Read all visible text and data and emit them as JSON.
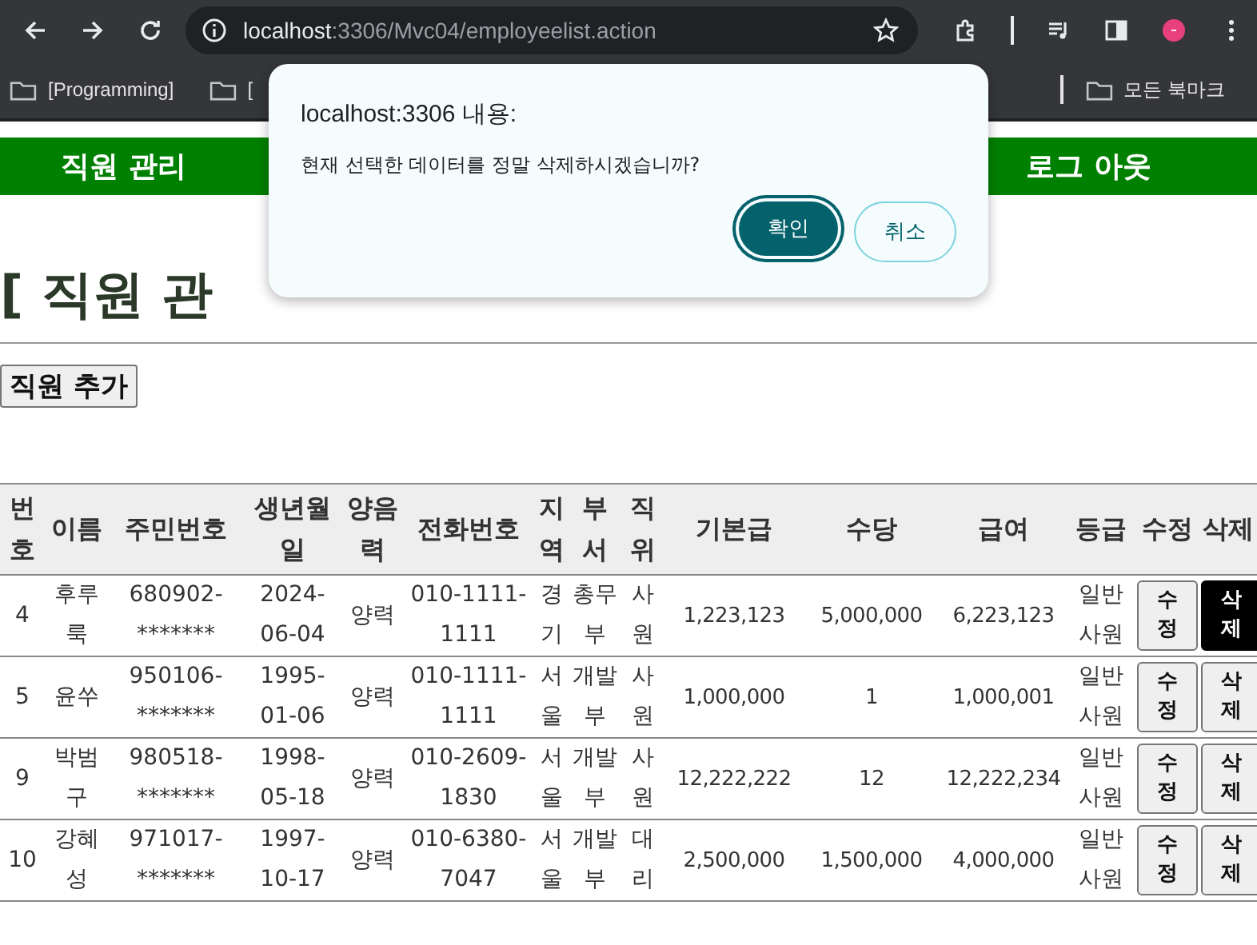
{
  "browser": {
    "url_host": "localhost",
    "url_path": ":3306/Mvc04/employeelist.action",
    "bookmarks": [
      {
        "label": "[Programming]"
      },
      {
        "label": "["
      }
    ],
    "all_bookmarks": "모든 북마크"
  },
  "nav": {
    "left": "직원 관리",
    "right": "로그 아웃"
  },
  "heading": {
    "start": "[ 직원 관"
  },
  "add_button": "직원 추가",
  "table": {
    "columns": [
      "번호",
      "이름",
      "주민번호",
      "생년월일",
      "양음력",
      "전화번호",
      "지역",
      "부서",
      "직위",
      "기본급",
      "수당",
      "급여",
      "등급",
      "수정",
      "삭제"
    ],
    "rows": [
      {
        "cells": [
          "4",
          "후루룩",
          "680902-*******",
          "2024-06-04",
          "양력",
          "010-1111-1111",
          "경기",
          "총무부",
          "사원",
          "1,223,123",
          "5,000,000",
          "6,223,123",
          "일반사원"
        ],
        "edit": "수정",
        "delete": "삭제",
        "delete_focused": true
      },
      {
        "cells": [
          "5",
          "윤쑤",
          "950106-*******",
          "1995-01-06",
          "양력",
          "010-1111-1111",
          "서울",
          "개발부",
          "사원",
          "1,000,000",
          "1",
          "1,000,001",
          "일반사원"
        ],
        "edit": "수정",
        "delete": "삭제",
        "delete_focused": false
      },
      {
        "cells": [
          "9",
          "박범구",
          "980518-*******",
          "1998-05-18",
          "양력",
          "010-2609-1830",
          "서울",
          "개발부",
          "사원",
          "12,222,222",
          "12",
          "12,222,234",
          "일반사원"
        ],
        "edit": "수정",
        "delete": "삭제",
        "delete_focused": false
      },
      {
        "cells": [
          "10",
          "강혜성",
          "971017-*******",
          "1997-10-17",
          "양력",
          "010-6380-7047",
          "서울",
          "개발부",
          "대리",
          "2,500,000",
          "1,500,000",
          "4,000,000",
          "일반사원"
        ],
        "edit": "수정",
        "delete": "삭제",
        "delete_focused": false
      }
    ]
  },
  "dialog": {
    "title": "localhost:3306 내용:",
    "message": "현재 선택한 데이터를 정말 삭제하시겠습니까?",
    "ok": "확인",
    "cancel": "취소"
  }
}
